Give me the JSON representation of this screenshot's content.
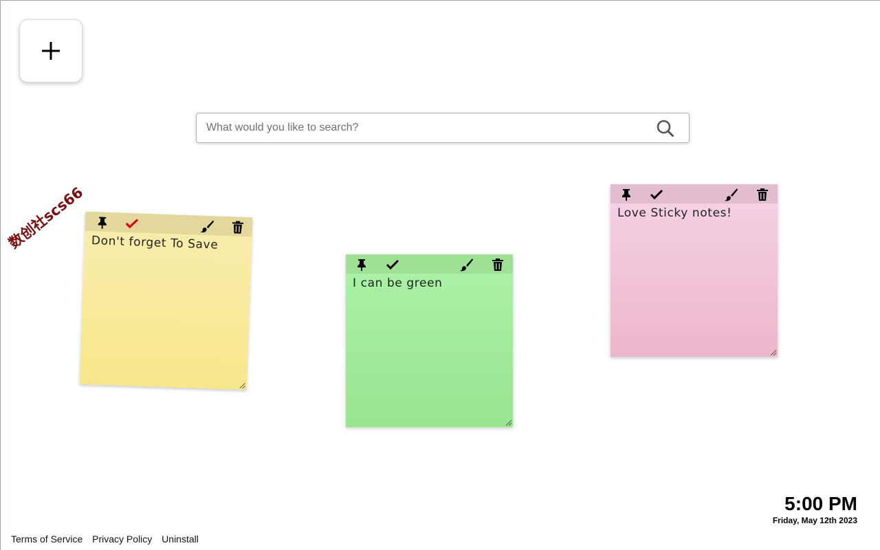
{
  "add_button": {
    "label": "+"
  },
  "search": {
    "placeholder": "What would you like to search?",
    "value": ""
  },
  "notes": [
    {
      "text": "Don't forget To Save",
      "color": "#f7e78a",
      "done": true,
      "check_color": "#e00000"
    },
    {
      "text": "I can be green",
      "color": "#98e590",
      "done": false,
      "check_color": "#000000"
    },
    {
      "text": "Love Sticky notes!",
      "color": "#edb6cd",
      "done": false,
      "check_color": "#000000"
    }
  ],
  "note_icons": [
    "pin-icon",
    "check-icon",
    "brush-icon",
    "trash-icon"
  ],
  "watermark": "数创社scs66",
  "clock": {
    "time": "5:00 PM",
    "date": "Friday, May 12th 2023"
  },
  "footer": {
    "links": [
      "Terms of Service",
      "Privacy Policy",
      "Uninstall"
    ]
  }
}
